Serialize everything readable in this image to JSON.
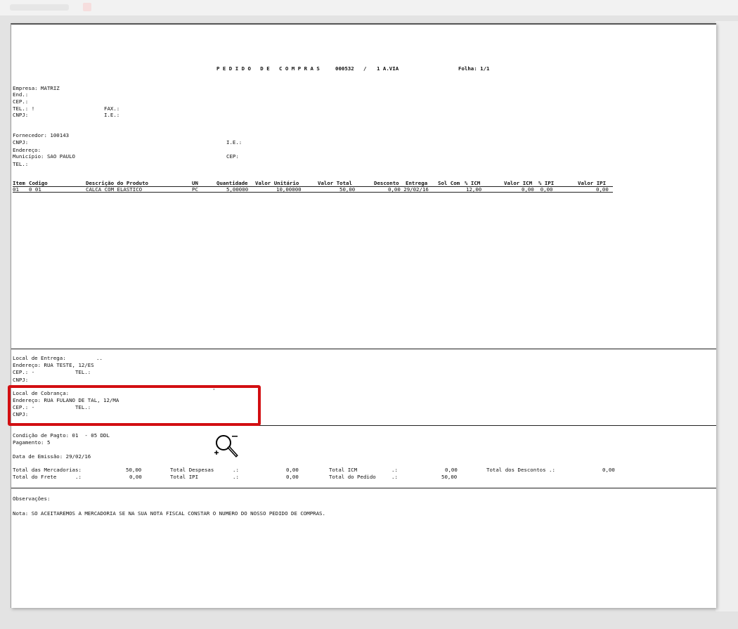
{
  "title": {
    "text": "P E D I D O   D E   C O M P R A S",
    "number": "000532",
    "slash": "/",
    "via": "1 A.VIA",
    "folha": "Folha: 1/1"
  },
  "empresa": {
    "empresa": "Empresa: MATRIZ",
    "end": "End.:",
    "cep": "CEP.:",
    "tel": "TEL.: !",
    "cnpj": "CNPJ:",
    "fax": "FAX.:",
    "ie": "I.E.:"
  },
  "fornecedor": {
    "fornecedor": "Fornecedor: 100143",
    "cnpj": "CNPJ:",
    "endereco": "Endereço:",
    "municipio": "Município: SAO PAULO",
    "tel": "TEL.:",
    "ie": "I.E.:",
    "cep": "CEP:"
  },
  "table": {
    "headers": {
      "item": "Item",
      "codigo": "Codigo",
      "descricao": "Descrição do Produto",
      "un": "UN",
      "quantidade": "Quantidade",
      "valor_unitario": "Valor Unitário",
      "valor_total": "Valor Total",
      "desconto": "Desconto",
      "entrega": "Entrega",
      "sol_com": "Sol Com",
      "pct_icm": "% ICM",
      "valor_icm": "Valor ICM",
      "pct_ipi": "% IPI",
      "valor_ipi": "Valor IPI"
    },
    "row": {
      "item": "01",
      "codigo": "0 01",
      "descricao": "CALCA COM ELASTICO",
      "un": "PC",
      "quantidade": "5,00000",
      "valor_unitario": "10,00000",
      "valor_total": "50,00",
      "desconto_entrega": "0,00 29/02/16",
      "pct_icm": "12,00",
      "valor_icm_pct_ipi": "0,00  0,00",
      "valor_ipi": "0,00"
    }
  },
  "entrega": {
    "local": "Local de Entrega:",
    "local_value": "..",
    "endereco": "Endereço: RUA TESTE, 12/ES",
    "cep": "CEP.: -",
    "tel": "TEL.:",
    "cnpj": "CNPJ:"
  },
  "cobranca": {
    "local": "Local de Cobrança:",
    "dot": "'",
    "endereco": "Endereço: RUA FULANO DE TAL, 12/MA",
    "cep": "CEP.: -",
    "tel": "TEL.:",
    "cnpj": "CNPJ:"
  },
  "pagamento": {
    "condicao": "Condição de Pagto: 01  - 05 DDL",
    "pagamento": "Pagamento: 5",
    "emissao": "Data de Emissão: 29/02/16"
  },
  "totals": {
    "mercadorias_label": "Total das Mercadorias:",
    "mercadorias_value": "50,00",
    "frete_label": "Total do Frete      .:",
    "frete_value": "0,00",
    "despesas_label": "Total Despesas      .:",
    "despesas_value": "0,00",
    "ipi_label": "Total IPI           .:",
    "ipi_value": "0,00",
    "icm_label": "Total ICM           .:",
    "icm_value": "0,00",
    "pedido_label": "Total do Pedido     .:",
    "pedido_value": "50,00",
    "descontos_label": "Total dos Descontos .:",
    "descontos_value": "0,00"
  },
  "observacoes": {
    "label": "Observações:",
    "nota": "Nota: SO ACEITAREMOS A MERCADORIA SE NA SUA NOTA FISCAL CONSTAR O NUMERO DO NOSSO PEDIDO DE COMPRAS."
  },
  "icons": {
    "zoom": "zoom-out-magnifier-icon"
  },
  "colors": {
    "highlight": "#d20f12"
  }
}
